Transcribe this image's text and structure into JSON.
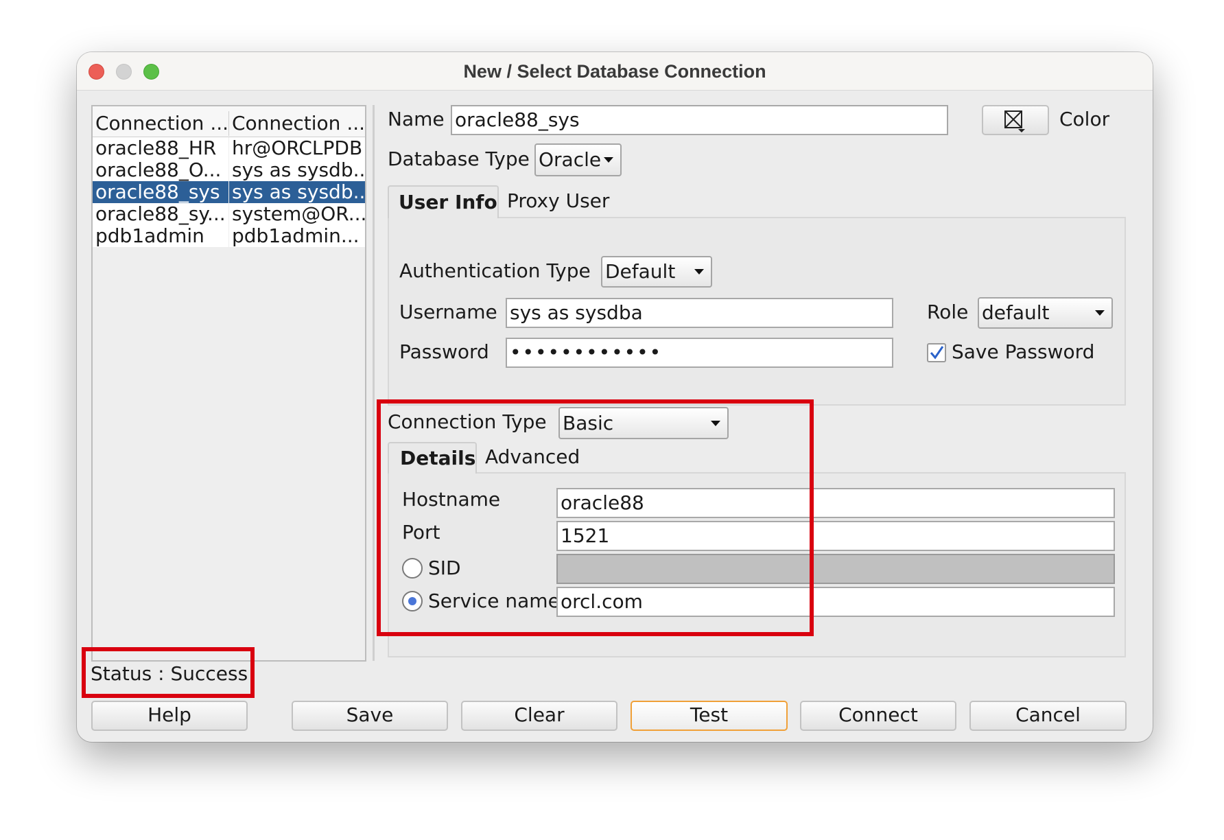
{
  "window": {
    "title": "New / Select Database Connection",
    "accent_colors": {
      "selection": "#2c5f97",
      "highlight_box": "#d9000f",
      "close": "#ec5f57",
      "zoom": "#5cc048"
    }
  },
  "connections": {
    "headers": [
      "Connection ...",
      "Connection ..."
    ],
    "rows": [
      {
        "name": "oracle88_HR",
        "details": "hr@ORCLPDB"
      },
      {
        "name": "oracle88_O...",
        "details": "sys as sysdb..."
      },
      {
        "name": "oracle88_sys",
        "details": "sys as sysdb..."
      },
      {
        "name": "oracle88_sy...",
        "details": "system@OR..."
      },
      {
        "name": "pdb1admin",
        "details": "pdb1admin..."
      }
    ]
  },
  "name_row": {
    "label": "Name",
    "value": "oracle88_sys",
    "color_label": "Color",
    "color_icon": "color-picker-icon"
  },
  "db_type": {
    "label": "Database Type",
    "value": "Oracle"
  },
  "user_tabs": [
    "User Info",
    "Proxy User"
  ],
  "auth": {
    "label": "Authentication Type",
    "value": "Default"
  },
  "username": {
    "label": "Username",
    "value": "sys as sysdba"
  },
  "password": {
    "label": "Password",
    "value": "••••••••••••"
  },
  "role": {
    "label": "Role",
    "value": "default"
  },
  "save_password": {
    "label": "Save Password",
    "checked": true
  },
  "connection_type": {
    "label": "Connection Type",
    "value": "Basic"
  },
  "detail_tabs": [
    "Details",
    "Advanced"
  ],
  "hostname": {
    "label": "Hostname",
    "value": "oracle88"
  },
  "port": {
    "label": "Port",
    "value": "1521"
  },
  "sid": {
    "label": "SID",
    "value": "",
    "selected": false
  },
  "service": {
    "label": "Service name",
    "value": "orcl.com",
    "selected": true
  },
  "status": {
    "text": "Status : Success"
  },
  "buttons": {
    "help": "Help",
    "save": "Save",
    "clear": "Clear",
    "test": "Test",
    "connect": "Connect",
    "cancel": "Cancel"
  }
}
